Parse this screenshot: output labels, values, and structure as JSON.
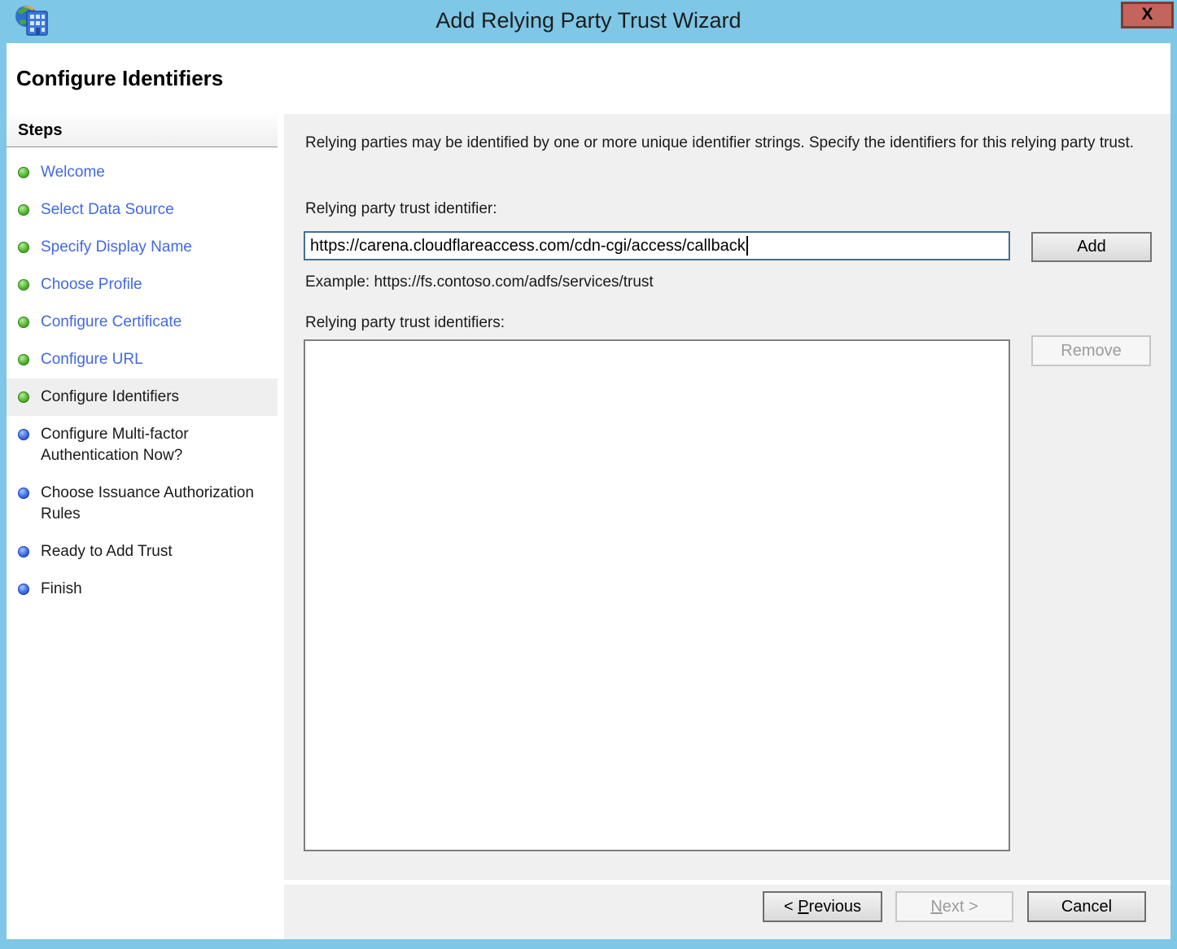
{
  "window": {
    "title": "Add Relying Party Trust Wizard",
    "close_label": "X",
    "page_title": "Configure Identifiers"
  },
  "colors": {
    "titlebar_blue": "#7EC7E6",
    "close_button_red": "#C3655C",
    "panel_gray": "#F0F0F0",
    "link_blue": "#4169E1",
    "completed_step_green": "#56BB31",
    "pending_step_blue": "#3E6FE8"
  },
  "sidebar": {
    "title": "Steps",
    "items": [
      {
        "label": "Welcome",
        "state": "done"
      },
      {
        "label": "Select Data Source",
        "state": "done"
      },
      {
        "label": "Specify Display Name",
        "state": "done"
      },
      {
        "label": "Choose Profile",
        "state": "done"
      },
      {
        "label": "Configure Certificate",
        "state": "done"
      },
      {
        "label": "Configure URL",
        "state": "done"
      },
      {
        "label": "Configure Identifiers",
        "state": "current"
      },
      {
        "label": "Configure Multi-factor Authentication Now?",
        "state": "pending"
      },
      {
        "label": "Choose Issuance Authorization Rules",
        "state": "pending"
      },
      {
        "label": "Ready to Add Trust",
        "state": "pending"
      },
      {
        "label": "Finish",
        "state": "pending"
      }
    ]
  },
  "main": {
    "intro": "Relying parties may be identified by one or more unique identifier strings. Specify the identifiers for this relying party trust.",
    "identifier_label": "Relying party trust identifier:",
    "identifier_value": "https://carena.cloudflareaccess.com/cdn-cgi/access/callback",
    "add_label": "Add",
    "example": "Example: https://fs.contoso.com/adfs/services/trust",
    "identifiers_label": "Relying party trust identifiers:",
    "identifiers_list": [],
    "remove_label": "Remove"
  },
  "footer": {
    "previous": {
      "prefix": "< ",
      "accel": "P",
      "suffix": "revious"
    },
    "next": {
      "accel": "N",
      "suffix": "ext >"
    },
    "cancel": "Cancel"
  }
}
